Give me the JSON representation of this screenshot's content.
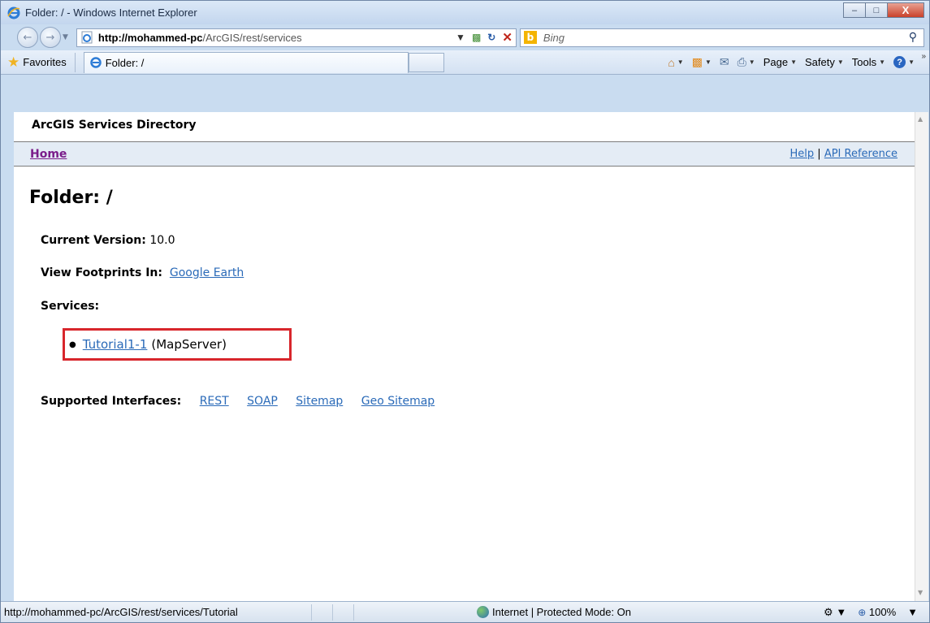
{
  "window": {
    "title": "Folder: / - Windows Internet Explorer",
    "min_glyph": "–",
    "max_glyph": "□",
    "close_glyph": "X"
  },
  "address_bar": {
    "url_host": "http://mohammed-pc",
    "url_path": "/ArcGIS/rest/services",
    "search_placeholder": "Bing"
  },
  "command_bar": {
    "favorites_label": "Favorites",
    "tab_label": "Folder: /",
    "page_label": "Page",
    "safety_label": "Safety",
    "tools_label": "Tools",
    "dropdown_arrow": "▼"
  },
  "page": {
    "directory_title": "ArcGIS Services Directory",
    "home_link": "Home",
    "help_link": "Help",
    "separator": "|",
    "api_link": "API Reference",
    "folder_title": "Folder: /",
    "current_version_label": "Current Version:",
    "current_version_value": "10.0",
    "view_footprints_label": "View Footprints In:",
    "google_earth_link": "Google Earth",
    "services_label": "Services:",
    "services": [
      {
        "name": "Tutorial1-1",
        "type": "(MapServer)"
      }
    ],
    "supported_interfaces_label": "Supported Interfaces:",
    "interfaces": [
      "REST",
      "SOAP",
      "Sitemap",
      "Geo Sitemap"
    ]
  },
  "status_bar": {
    "url": "http://mohammed-pc/ArcGIS/rest/services/Tutorial",
    "zone": "Internet | Protected Mode: On",
    "zoom": "100%"
  },
  "colors": {
    "link": "#2a6ab8",
    "visited_link": "#7a1c8a",
    "highlight_box": "#d8262c",
    "nav_bar_bg": "#e4ecf5"
  }
}
